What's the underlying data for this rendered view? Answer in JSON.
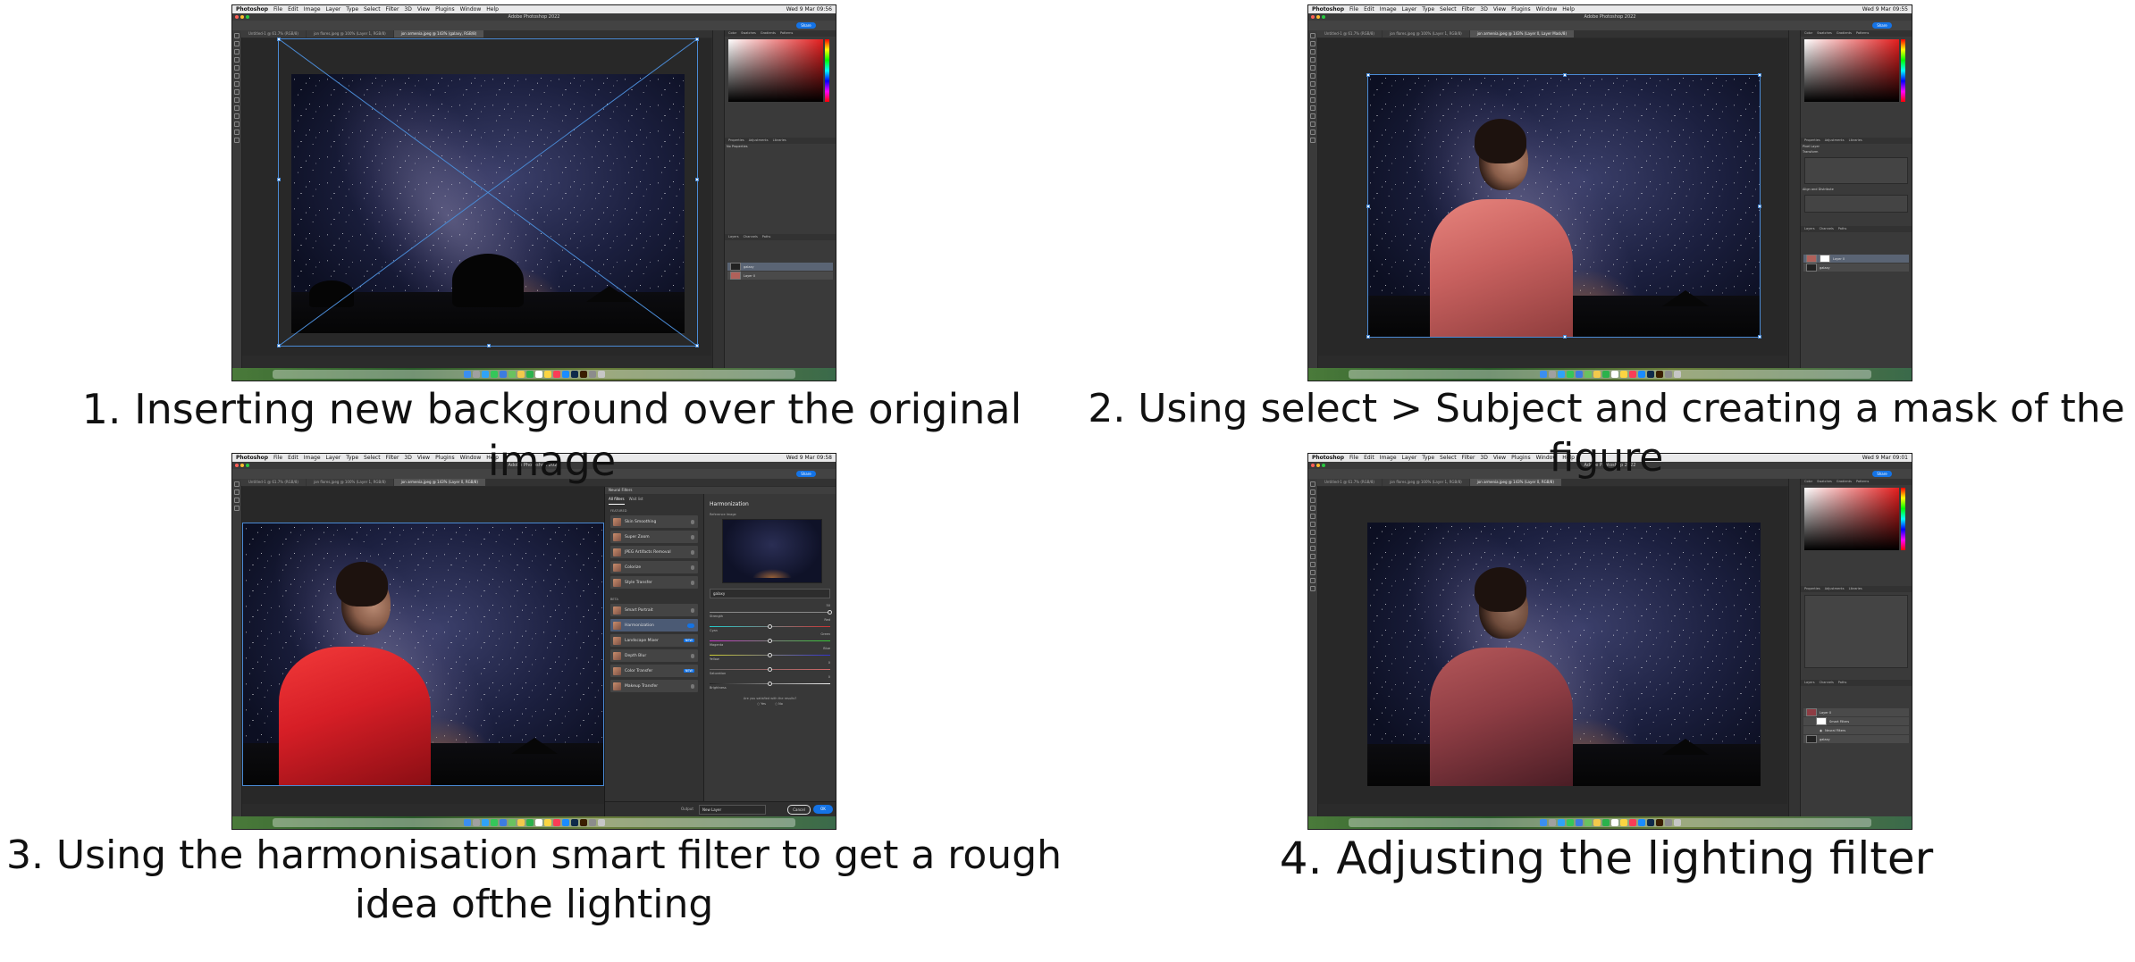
{
  "captions": [
    "1. Inserting new background over the original image",
    "2. Using select > Subject and creating a mask of the figure",
    "3. Using the harmonisation smart filter to get a rough idea ofthe lighting",
    "4. Adjusting the lighting filter"
  ],
  "app": {
    "name": "Photoshop",
    "window_title": "Adobe Photoshop 2022",
    "menus": [
      "File",
      "Edit",
      "Image",
      "Layer",
      "Type",
      "Select",
      "Filter",
      "3D",
      "View",
      "Plugins",
      "Window",
      "Help"
    ],
    "share_label": "Share",
    "clocks": [
      "Wed 9 Mar 09:56",
      "Wed 9 Mar 09:55",
      "Wed 9 Mar 09:58",
      "Wed 9 Mar 09:01"
    ]
  },
  "panels": {
    "color_tabs": [
      "Color",
      "Swatches",
      "Gradients",
      "Patterns"
    ],
    "property_tabs": [
      "Properties",
      "Adjustments",
      "Libraries"
    ],
    "layer_tabs": [
      "Layers",
      "Channels",
      "Paths"
    ],
    "no_properties": "No Properties",
    "pixel_layer": "Pixel Layer",
    "smart_object": "Smart Filters",
    "transform": "Transform",
    "align": "Align and Distribute"
  },
  "shot1": {
    "tabs": [
      "Untitled-1 @ 61.7% (RGB/8)",
      "jon flores.jpeg @ 100% (Layer 1, RGB/8)",
      "jon armenia.jpeg @ 143% (galaxy, RGB/8)"
    ],
    "layers": [
      "galaxy",
      "Layer 0"
    ]
  },
  "shot2": {
    "tabs": [
      "Untitled-1 @ 61.7% (RGB/8)",
      "jon flores.jpeg @ 100% (Layer 1, RGB/8)",
      "jon armenia.jpeg @ 143% (Layer 0, Layer Mask/8)"
    ],
    "layers": [
      "Layer 0",
      "galaxy"
    ]
  },
  "shot3": {
    "tabs": [
      "Untitled-1 @ 61.7% (RGB/8)",
      "jon flores.jpeg @ 100% (Layer 1, RGB/8)",
      "jon armenia.jpeg @ 143% (Layer 0, RGB/8)"
    ],
    "neural_filters": {
      "panel_title": "Neural Filters",
      "list_tabs": [
        "All filters",
        "Wait list"
      ],
      "featured_label": "FEATURED",
      "featured": [
        "Skin Smoothing",
        "Super Zoom",
        "JPEG Artifacts Removal",
        "Colorize",
        "Style Transfer"
      ],
      "beta_label": "BETA",
      "beta": [
        {
          "name": "Smart Portrait",
          "badge": ""
        },
        {
          "name": "Harmonization",
          "badge": ""
        },
        {
          "name": "Landscape Mixer",
          "badge": "NEW"
        },
        {
          "name": "Depth Blur",
          "badge": ""
        },
        {
          "name": "Color Transfer",
          "badge": "NEW"
        },
        {
          "name": "Makeup Transfer",
          "badge": ""
        }
      ],
      "detail_title": "Harmonization",
      "reference_label": "Reference Image",
      "reference_layer": "galaxy",
      "sliders": [
        {
          "name": "Strength",
          "right": "50",
          "pos": 1.0
        },
        {
          "name": "Cyan",
          "right": "Red",
          "pos": 0.5
        },
        {
          "name": "Magenta",
          "right": "Green",
          "pos": 0.5
        },
        {
          "name": "Yellow",
          "right": "Blue",
          "pos": 0.5
        },
        {
          "name": "Saturation",
          "right": "0",
          "pos": 0.5
        },
        {
          "name": "Brightness",
          "right": "0",
          "pos": 0.5
        }
      ],
      "satisfied": "Are you satisfied with the results?",
      "yes": "Yes",
      "no": "No",
      "output_label": "Output",
      "output_value": "New Layer",
      "cancel": "Cancel",
      "ok": "OK"
    }
  },
  "shot4": {
    "tabs": [
      "Untitled-1 @ 61.7% (RGB/8)",
      "jon flores.jpeg @ 100% (Layer 1, RGB/8)",
      "jon armenia.jpeg @ 143% (Layer 0, RGB/8)"
    ],
    "layers": [
      "Layer 0",
      "Smart Filters",
      "Neural Filters",
      "galaxy"
    ]
  },
  "colors": {
    "ps_dark": "#2b2b2b",
    "ps_panel": "#3a3a3a",
    "accent_blue": "#1473e6",
    "jacket_pink": "#c8615f",
    "jacket_red": "#d61e26"
  }
}
